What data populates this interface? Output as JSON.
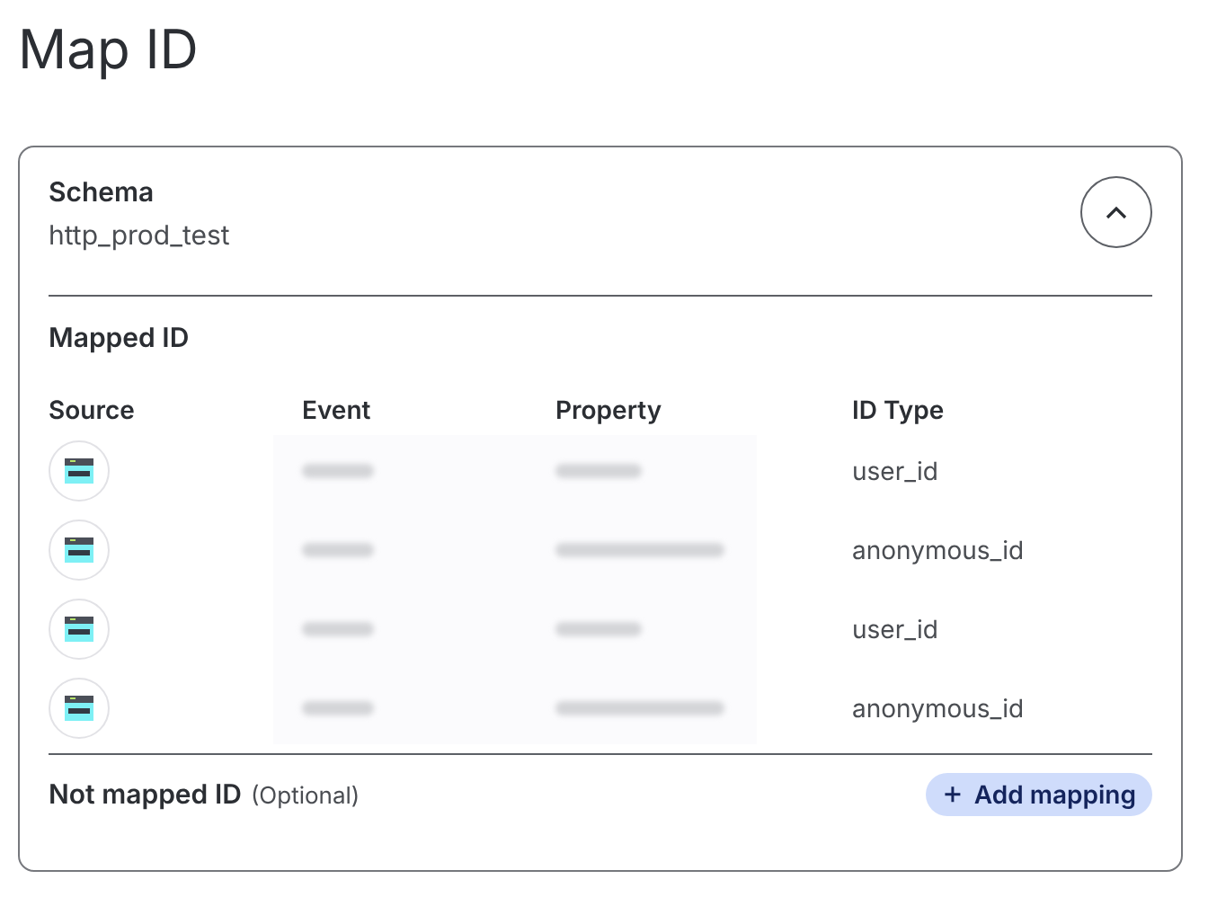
{
  "title": "Map ID",
  "schema": {
    "label": "Schema",
    "value": "http_prod_test",
    "expanded": true
  },
  "mapped": {
    "heading": "Mapped ID",
    "columns": [
      "Source",
      "Event",
      "Property",
      "ID Type"
    ],
    "rows": [
      {
        "event_blurred": true,
        "property_blurred": true,
        "id_type": "user_id"
      },
      {
        "event_blurred": true,
        "property_blurred": true,
        "id_type": "anonymous_id"
      },
      {
        "event_blurred": true,
        "property_blurred": true,
        "id_type": "user_id"
      },
      {
        "event_blurred": true,
        "property_blurred": true,
        "id_type": "anonymous_id"
      }
    ]
  },
  "not_mapped": {
    "heading": "Not mapped ID",
    "note": "(Optional)",
    "button": {
      "icon": "+",
      "label": "Add mapping"
    }
  }
}
